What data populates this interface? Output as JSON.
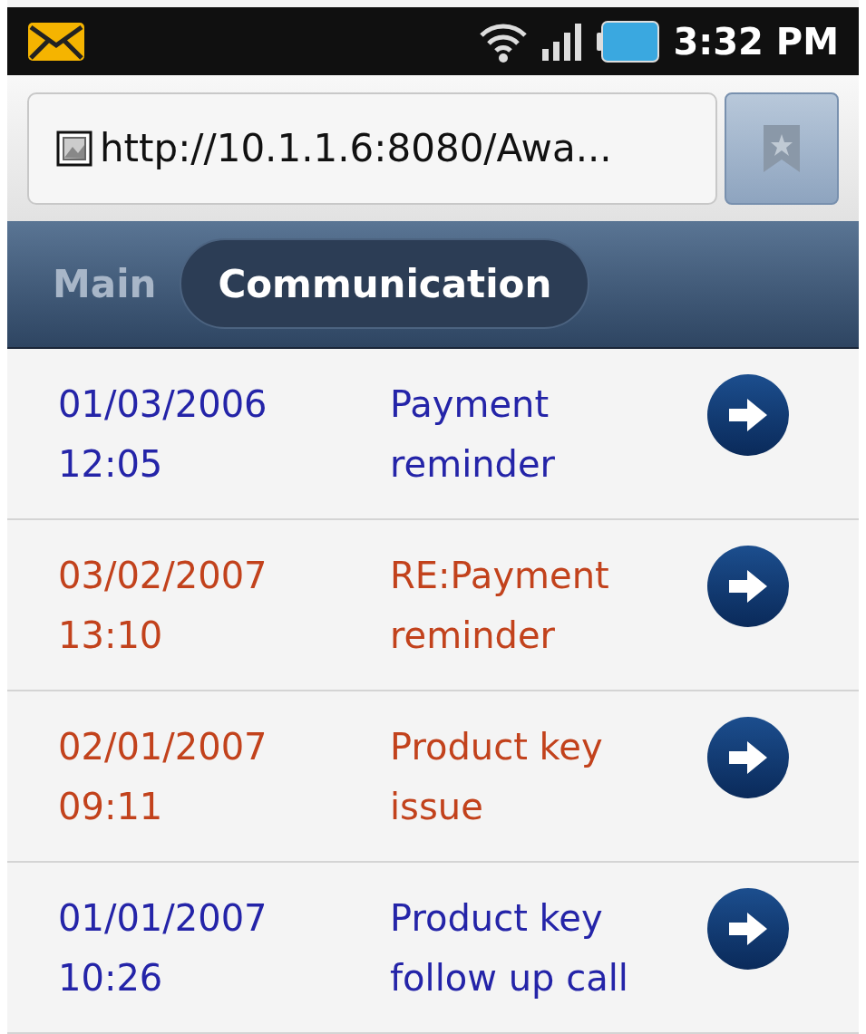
{
  "status_bar": {
    "time": "3:32 PM"
  },
  "address_bar": {
    "url": "http://10.1.1.6:8080/Awa..."
  },
  "tabs": [
    {
      "label": "Main",
      "selected": false
    },
    {
      "label": "Communication",
      "selected": true
    }
  ],
  "messages": [
    {
      "date": "01/03/2006",
      "time": "12:05",
      "subject": "Payment reminder",
      "color": "#2424a8"
    },
    {
      "date": "03/02/2007",
      "time": "13:10",
      "subject": "RE:Payment reminder",
      "color": "#c2421c"
    },
    {
      "date": "02/01/2007",
      "time": "09:11",
      "subject": "Product key issue",
      "color": "#c2421c"
    },
    {
      "date": "01/01/2007",
      "time": "10:26",
      "subject": "Product key follow up call",
      "color": "#2424a8"
    }
  ]
}
